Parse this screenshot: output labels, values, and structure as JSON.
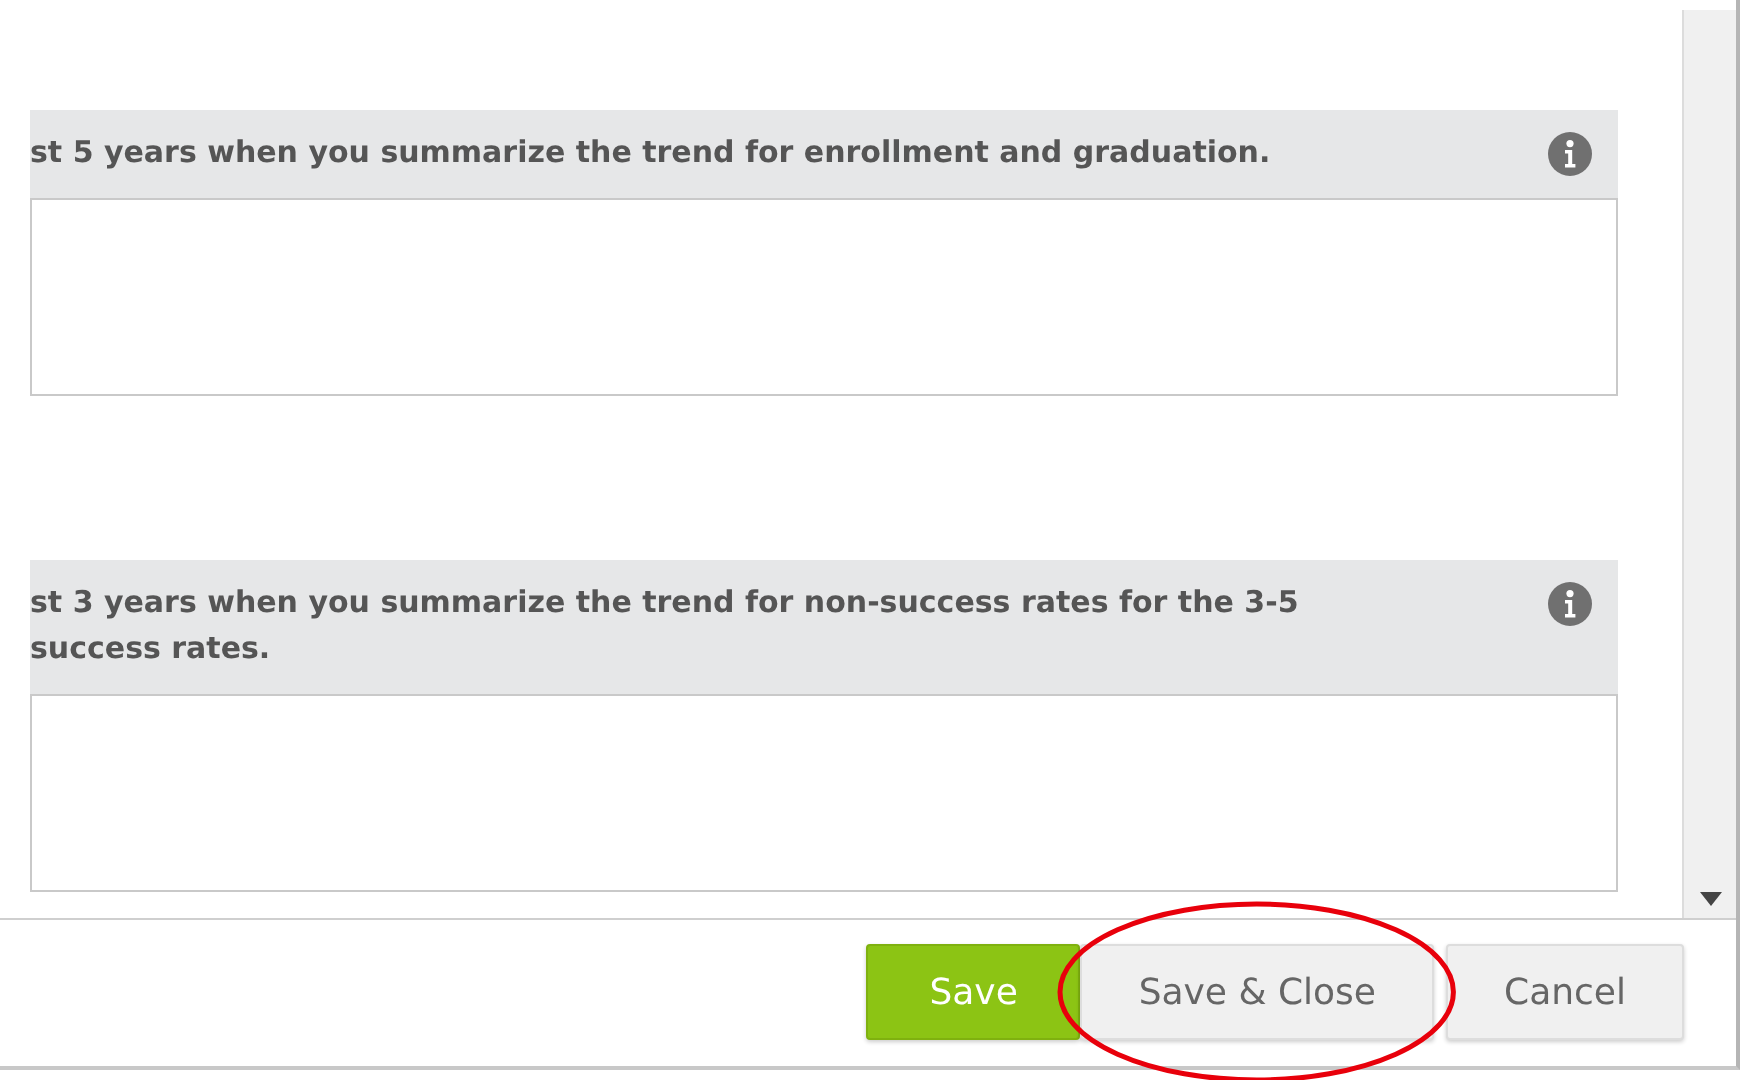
{
  "questions": [
    {
      "prompt": "st 5 years when you summarize the trend for enrollment and graduation."
    },
    {
      "prompt": "st 3 years when you summarize the trend for non-success rates for the 3-5 success rates."
    }
  ],
  "buttons": [
    {
      "label": "Save",
      "kind": "primary",
      "highlighted": false
    },
    {
      "label": "Save & Close",
      "kind": "default",
      "highlighted": true
    },
    {
      "label": "Cancel",
      "kind": "default",
      "highlighted": false
    }
  ]
}
